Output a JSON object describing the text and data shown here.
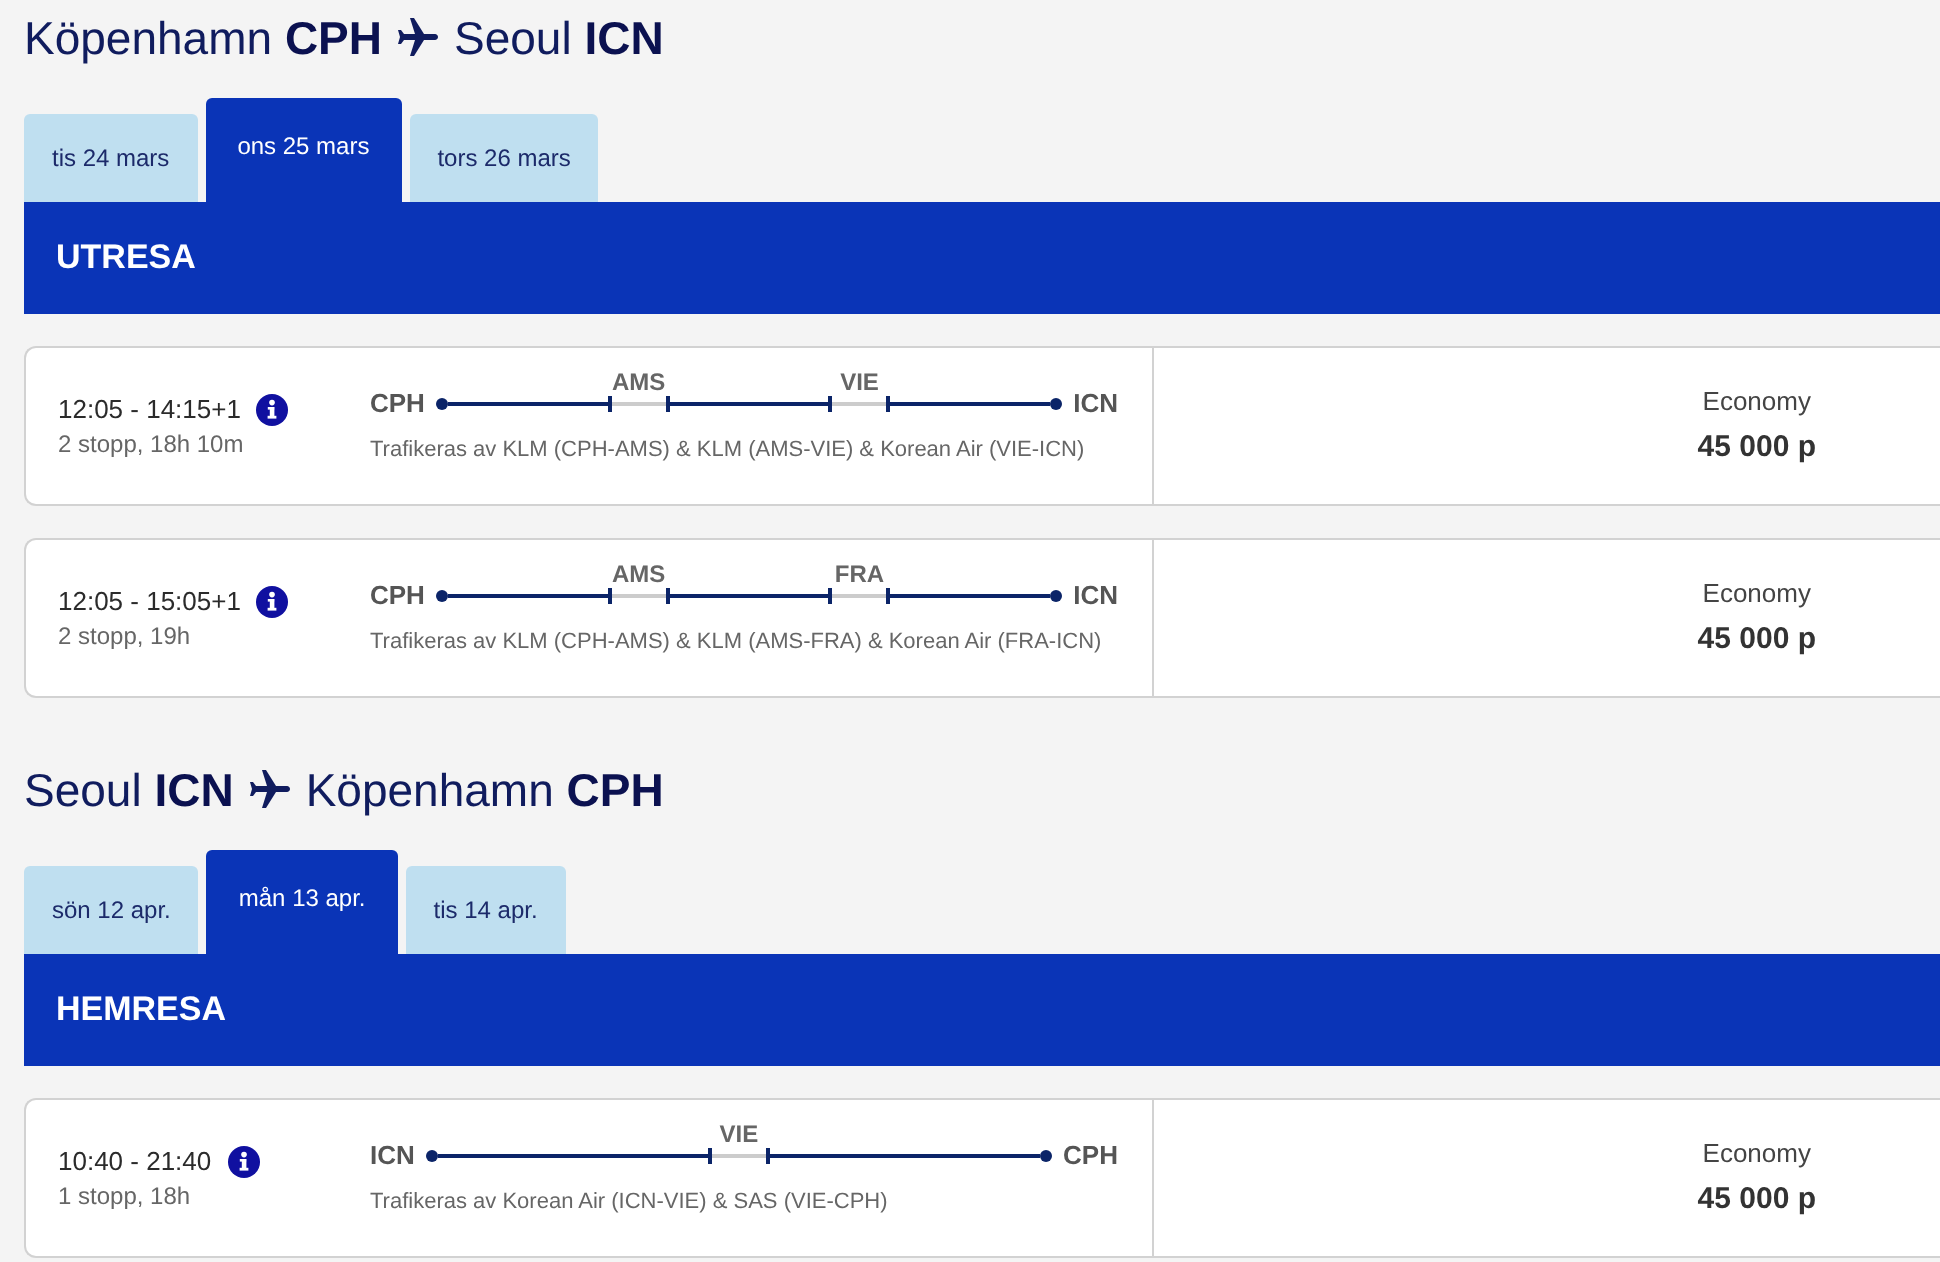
{
  "journeys": [
    {
      "heading": {
        "from": "Köpenhamn **CPH**",
        "to": "Seoul **ICN**"
      },
      "tabs": [
        {
          "label": "tis 24 mars",
          "selected": false
        },
        {
          "label": "ons 25 mars",
          "selected": true
        },
        {
          "label": "tors 26 mars",
          "selected": false
        }
      ],
      "title": "UTRESA",
      "flights": [
        {
          "times": "12:05 - 14:15+1",
          "summary": "2 stopp, 18h 10m",
          "origin": "CPH",
          "destination": "ICN",
          "stops": [
            {
              "code": "AMS"
            },
            {
              "code": "VIE"
            }
          ],
          "operated_by": "Trafikeras av KLM (CPH-AMS) & KLM (AMS-VIE) & Korean Air (VIE-ICN)",
          "cabin": "Economy",
          "price": "45 000 p"
        },
        {
          "times": "12:05 - 15:05+1",
          "summary": "2 stopp, 19h",
          "origin": "CPH",
          "destination": "ICN",
          "stops": [
            {
              "code": "AMS"
            },
            {
              "code": "FRA"
            }
          ],
          "operated_by": "Trafikeras av KLM (CPH-AMS) & KLM (AMS-FRA) & Korean Air (FRA-ICN)",
          "cabin": "Economy",
          "price": "45 000 p"
        }
      ]
    },
    {
      "heading": {
        "from": "Seoul **ICN**",
        "to": "Köpenhamn **CPH**"
      },
      "tabs": [
        {
          "label": "sön 12 apr.",
          "selected": false
        },
        {
          "label": "mån 13 apr.",
          "selected": true
        },
        {
          "label": "tis 14 apr.",
          "selected": false
        }
      ],
      "title": "HEMRESA",
      "flights": [
        {
          "times": "10:40 - 21:40",
          "summary": "1 stopp, 18h",
          "origin": "ICN",
          "destination": "CPH",
          "stops": [
            {
              "code": "VIE"
            }
          ],
          "operated_by": "Trafikeras av Korean Air (ICN-VIE) & SAS (VIE-CPH)",
          "cabin": "Economy",
          "price": "45 000 p"
        }
      ]
    }
  ]
}
